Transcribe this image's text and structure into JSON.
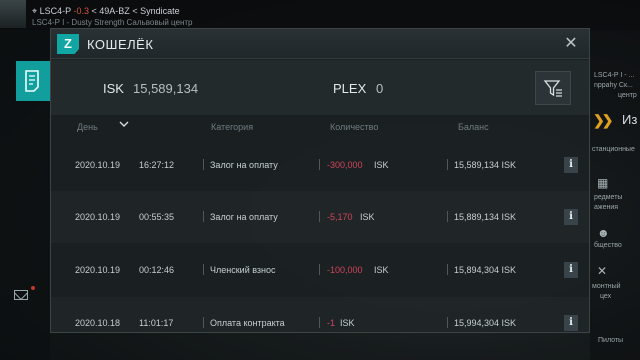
{
  "hud": {
    "system_name": "LSC4-P",
    "security": "-0.3",
    "region": "49A-BZ",
    "constellation": "Syndicate",
    "station": "LSC4-P I - Dusty Strength Сальвовый центр",
    "right_station": "LSC4-P I - ...",
    "right_station2": "nppahy Ск...",
    "right_station3": "центр",
    "right_big": "Из",
    "right_items": [
      "станционные",
      "редметы",
      "ажения",
      "бщество",
      "монтный",
      "цех",
      "Пилоты"
    ],
    "accent_color": "#11a6a4",
    "warning_color": "#e0a020"
  },
  "wallet": {
    "title": "КОШЕЛЁК",
    "logo_letter": "Z",
    "isk_label": "ISK",
    "isk_value": "15,589,134",
    "plex_label": "PLEX",
    "plex_value": "0",
    "columns": {
      "day": "День",
      "category": "Категория",
      "amount": "Количество",
      "balance": "Баланс"
    },
    "rows": [
      {
        "date": "2020.10.19",
        "time": "16:27:12",
        "category": "Залог на оплату",
        "amount": "-300,000",
        "currency": "ISK",
        "balance": "15,589,134 ISK"
      },
      {
        "date": "2020.10.19",
        "time": "00:55:35",
        "category": "Залог на оплату",
        "amount": "-5,170",
        "currency": "ISK",
        "balance": "15,889,134 ISK"
      },
      {
        "date": "2020.10.19",
        "time": "00:12:46",
        "category": "Членский взнос",
        "amount": "-100,000",
        "currency": "ISK",
        "balance": "15,894,304 ISK"
      },
      {
        "date": "2020.10.18",
        "time": "11:01:17",
        "category": "Оплата контракта",
        "amount": "-1",
        "currency": "ISK",
        "balance": "15,994,304 ISK"
      }
    ],
    "negative_color": "#d0455a",
    "info_glyph": "i"
  }
}
